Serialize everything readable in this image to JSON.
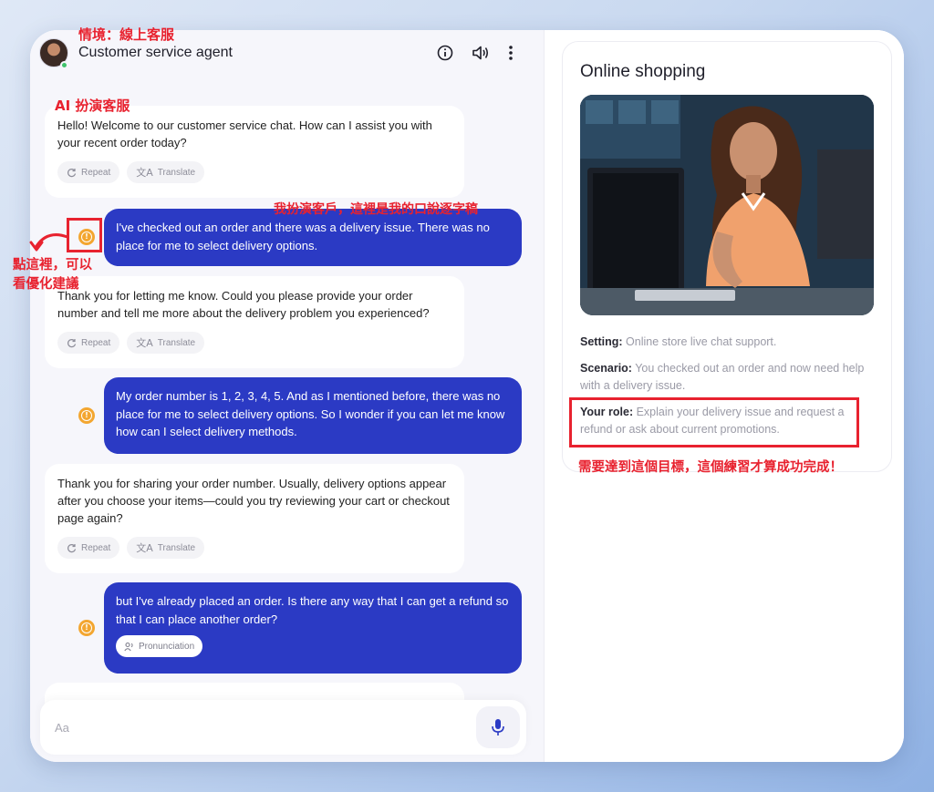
{
  "header": {
    "title": "Customer service agent"
  },
  "messages": [
    {
      "role": "ai",
      "text": "Hello! Welcome to our customer service chat. How can I assist you with your recent order today?",
      "repeat_label": "Repeat",
      "translate_label": "Translate"
    },
    {
      "role": "user",
      "text": "I've checked out an order and there was a delivery issue. There was no place for me to select delivery options."
    },
    {
      "role": "ai",
      "text": "Thank you for letting me know. Could you please provide your order number and tell me more about the delivery problem you experienced?",
      "repeat_label": "Repeat",
      "translate_label": "Translate"
    },
    {
      "role": "user",
      "text": "My order number is 1, 2, 3, 4, 5. And as I mentioned before, there was no place for me to select delivery options. So I wonder if you can let me know how can I select delivery methods."
    },
    {
      "role": "ai",
      "text": "Thank you for sharing your order number. Usually, delivery options appear after you choose your items—could you try reviewing your cart or checkout page again?",
      "repeat_label": "Repeat",
      "translate_label": "Translate"
    },
    {
      "role": "user",
      "text": "but I've already placed an order. Is there any way that I can get a refund so that I can place another order?",
      "pronunciation_label": "Pronunciation"
    }
  ],
  "composer": {
    "placeholder": "Aa"
  },
  "panel": {
    "title": "Online shopping",
    "setting_label": "Setting:",
    "setting_value": "Online store live chat support.",
    "scenario_label": "Scenario:",
    "scenario_value": "You checked out an order and now need help with a delivery issue.",
    "role_label": "Your role:",
    "role_value": "Explain your delivery issue and request a refund or ask about current promotions."
  },
  "annotations": {
    "scene": "情境：線上客服",
    "ai_role": "AI 扮演客服",
    "user_role": "我扮演客戶，這裡是我的口說逐字稿",
    "click_hint_line1": "點這裡，可以",
    "click_hint_line2": "看優化建議",
    "goal": "需要達到這個目標，這個練習才算成功完成！"
  },
  "colors": {
    "user_bubble": "#2b3ac4",
    "annotation_red": "#e8222f",
    "suggestion_orange": "#f3a630",
    "online_green": "#3fc36b"
  },
  "icons": {
    "header": [
      "info-icon",
      "speaker-icon",
      "more-vertical-icon"
    ],
    "composer": "microphone-icon",
    "repeat": "repeat-icon",
    "translate": "translate-icon",
    "pronunciation": "pronunciation-icon",
    "suggestion": "suggestion-icon"
  }
}
